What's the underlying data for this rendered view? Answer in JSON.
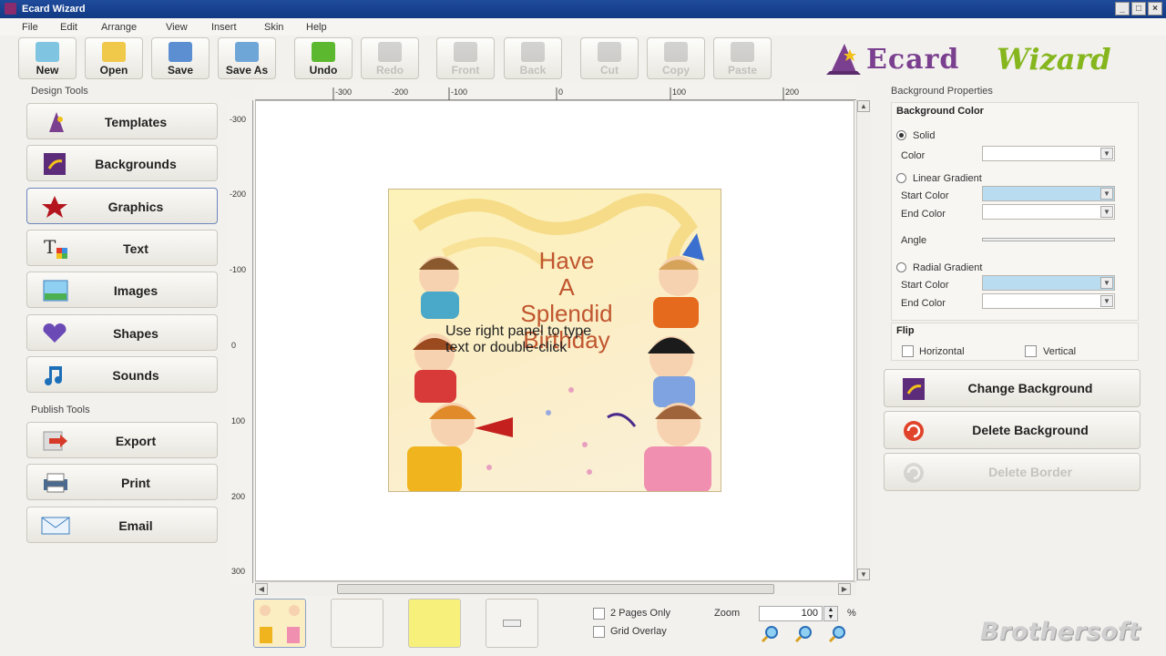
{
  "window": {
    "title": "Ecard Wizard",
    "controls": [
      "_",
      "□",
      "×"
    ]
  },
  "menu": [
    "File",
    "Edit",
    "Arrange",
    "View",
    "Insert",
    "Skin",
    "Help"
  ],
  "toolbar": {
    "new": "New",
    "open": "Open",
    "save": "Save",
    "save_as": "Save As",
    "undo": "Undo",
    "redo": "Redo",
    "front": "Front",
    "back": "Back",
    "cut": "Cut",
    "copy": "Copy",
    "paste": "Paste"
  },
  "logo": {
    "part1": "Ecard",
    "part2": "Wizard"
  },
  "design_tools": {
    "title": "Design Tools",
    "items": [
      "Templates",
      "Backgrounds",
      "Graphics",
      "Text",
      "Images",
      "Shapes",
      "Sounds"
    ],
    "active": "Graphics"
  },
  "publish_tools": {
    "title": "Publish Tools",
    "items": [
      "Export",
      "Print",
      "Email"
    ]
  },
  "rulers": {
    "top": [
      "-300",
      "-200",
      "-100",
      "0",
      "100",
      "200"
    ],
    "left": [
      "-300",
      "-200",
      "-100",
      "0",
      "100",
      "200",
      "300"
    ]
  },
  "card": {
    "headline_lines": [
      "Have",
      "A",
      "Splendid",
      "Birthday"
    ],
    "hint_lines": [
      "Use right panel to type",
      "text or double-click"
    ]
  },
  "bottom": {
    "two_pages_only": "2 Pages Only",
    "grid_overlay": "Grid Overlay",
    "zoom_label": "Zoom",
    "zoom_value": "100",
    "zoom_unit": "%"
  },
  "background_properties": {
    "title": "Background Properties",
    "color_section": "Background Color",
    "solid": "Solid",
    "color": "Color",
    "linear_gradient": "Linear Gradient",
    "start_color": "Start Color",
    "end_color": "End Color",
    "angle": "Angle",
    "radial_gradient": "Radial Gradient",
    "flip": "Flip",
    "horizontal": "Horizontal",
    "vertical": "Vertical",
    "selected_fill": "Solid"
  },
  "actions": {
    "change_background": "Change Background",
    "delete_background": "Delete Background",
    "delete_border": "Delete Border"
  },
  "watermark": "Brothersoft",
  "colors": {
    "accent": "#7b3f8f",
    "brand_green": "#86b61e",
    "gradient_swatch": "#b9dcf0",
    "headline": "#c0562f"
  }
}
